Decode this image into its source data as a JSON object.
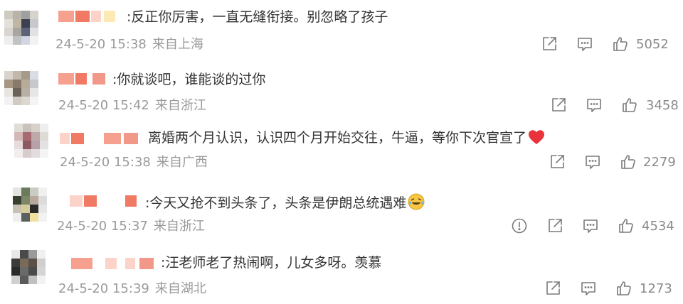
{
  "comments": [
    {
      "text": ":反正你厉害，一直无缝衔接。别忽略了孩子",
      "date": "24-5-20 15:38",
      "location": "来自上海",
      "likes": "5052",
      "has_report": false,
      "emoji": ""
    },
    {
      "text": ":你就谈吧，谁能谈的过你",
      "date": "24-5-20 15:42",
      "location": "来自浙江",
      "likes": "3458",
      "has_report": false,
      "emoji": ""
    },
    {
      "text": "离婚两个月认识，认识四个月开始交往，牛逼，等你下次官宣了",
      "date": "24-5-20 15:38",
      "location": "来自广西",
      "likes": "2279",
      "has_report": false,
      "emoji": "heart-emoji"
    },
    {
      "text": ":今天又抢不到头条了，头条是伊朗总统遇难",
      "date": "24-5-20 15:37",
      "location": "来自浙江",
      "likes": "4534",
      "has_report": true,
      "emoji": "laugh-cry-emoji"
    },
    {
      "text": ":汪老师老了热闹啊，儿女多呀。羡慕",
      "date": "24-5-20 15:39",
      "location": "来自湖北",
      "likes": "1273",
      "has_report": false,
      "emoji": ""
    }
  ],
  "colors": {
    "text": "#333333",
    "meta": "#9a9a9a",
    "icon": "#7a7a7a",
    "name_blur": "#f07a64",
    "heart": "#e8333a"
  }
}
